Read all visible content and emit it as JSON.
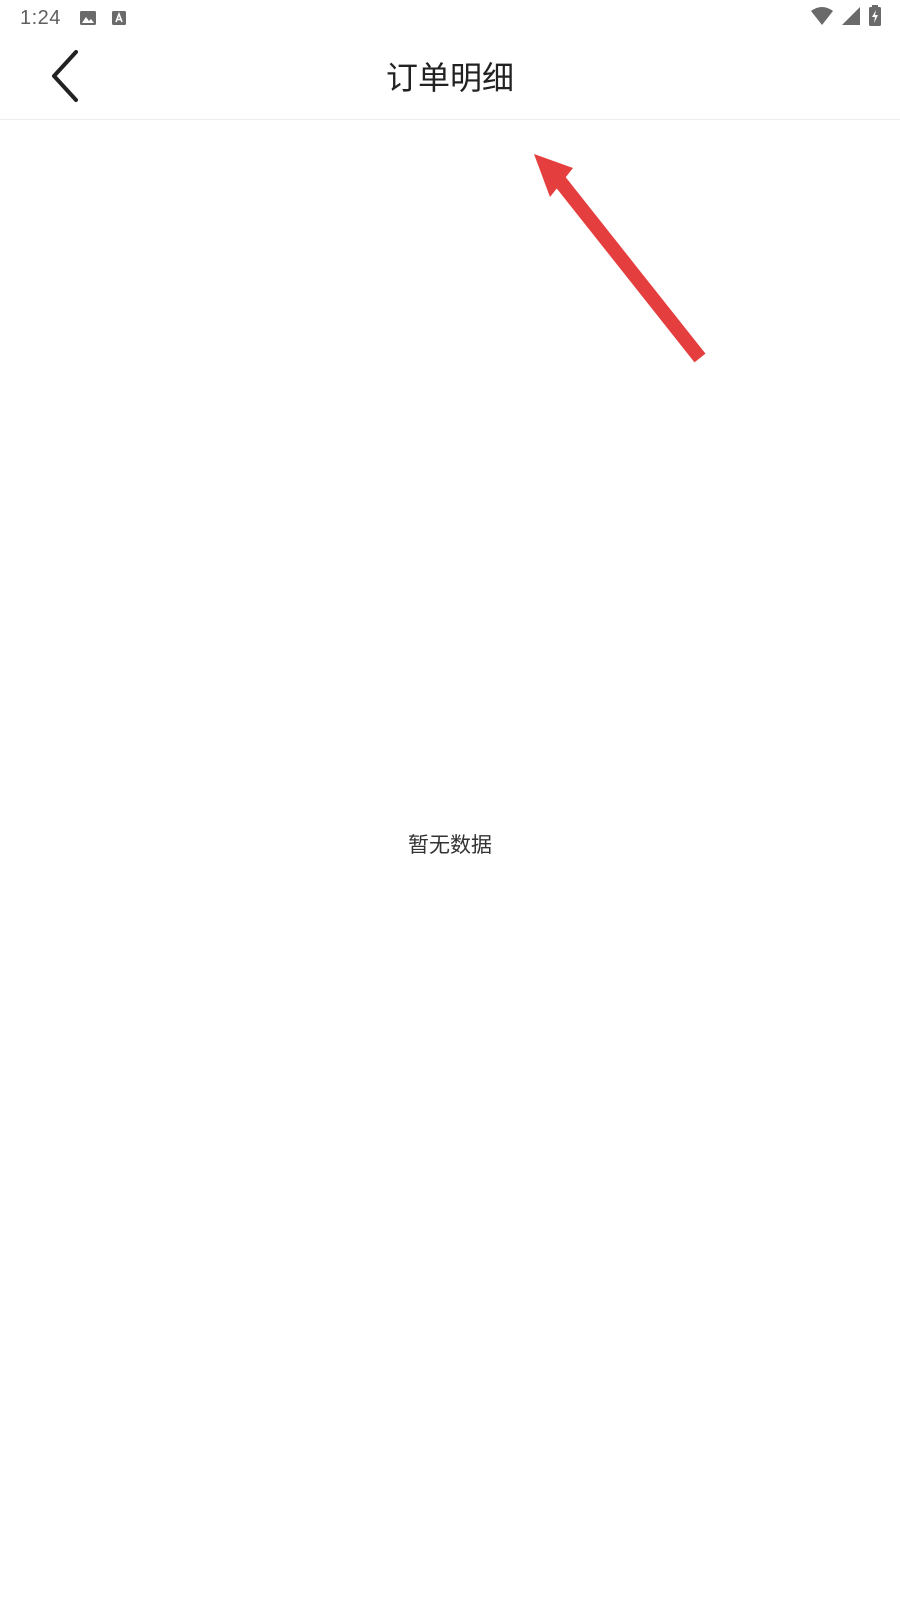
{
  "status_bar": {
    "time": "1:24",
    "left_icons": [
      "image-icon",
      "text-a-icon"
    ],
    "right_icons": [
      "wifi-icon",
      "cell-signal-icon",
      "battery-charging-icon"
    ]
  },
  "app_bar": {
    "back_icon": "chevron-left-icon",
    "title": "订单明细"
  },
  "content": {
    "empty_message": "暂无数据"
  },
  "annotation": {
    "type": "arrow",
    "color": "#e53e3e",
    "points_to": "page-title"
  }
}
